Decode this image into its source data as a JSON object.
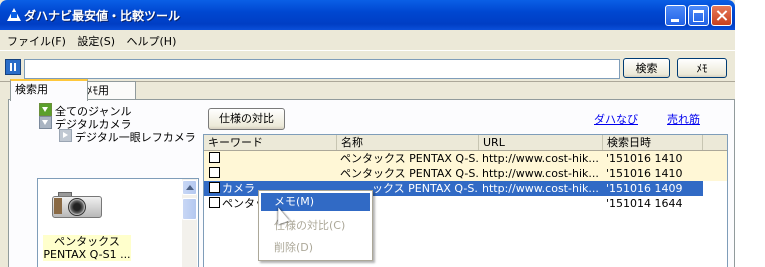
{
  "window": {
    "title": "ダハナビ最安値・比較ツール"
  },
  "menu": [
    "ファイル(F)",
    "設定(S)",
    "ヘルプ(H)"
  ],
  "toolbar": {
    "search_value": "",
    "search_label": "検索",
    "memo_label": "ﾒﾓ"
  },
  "tabs": [
    {
      "label": "検索用"
    },
    {
      "label": "ﾒﾓ用"
    }
  ],
  "tree": [
    {
      "label": "全てのジャンル"
    },
    {
      "label": "デジタルカメラ"
    },
    {
      "label": "デジタル一眼レフカメラ"
    }
  ],
  "product": {
    "label": "ペンタックス PENTAX Q-S1 ..."
  },
  "actions": {
    "spec_compare": "仕様の対比",
    "dahanabi": "ダハなび",
    "urezuji": "売れ筋"
  },
  "grid": {
    "columns": [
      "キーワード",
      "名称",
      "URL",
      "検索日時"
    ],
    "rows": [
      {
        "keyword": "",
        "name": "ペンタックス PENTAX Q-S...",
        "url": "http://www.cost-hik...",
        "date": "'151016 1410"
      },
      {
        "keyword": "",
        "name": "ペンタックス PENTAX Q-S...",
        "url": "http://www.cost-hik...",
        "date": "'151016 1410"
      },
      {
        "keyword": "カメラ",
        "name": "ックス PENTAX Q-S...",
        "url": "http://www.cost-hik...",
        "date": "'151016 1409"
      },
      {
        "keyword": "ペンタッ",
        "name": "",
        "url": "",
        "date": "'151014 1644"
      }
    ]
  },
  "context_menu": {
    "items": [
      {
        "label": "メモ(M)",
        "state": "highlighted"
      },
      {
        "label": "仕様の対比(C)",
        "state": "disabled"
      },
      {
        "label": "削除(D)",
        "state": "disabled"
      }
    ]
  }
}
